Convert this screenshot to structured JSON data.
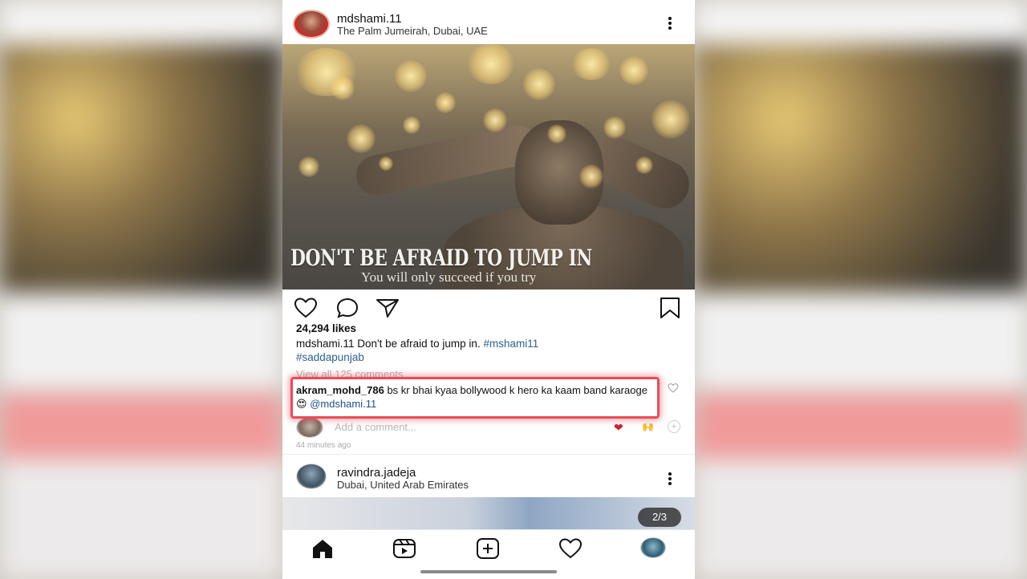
{
  "post1": {
    "username": "mdshami.11",
    "location": "The Palm Jumeirah, Dubai, UAE",
    "image_headline": "DON'T BE AFRAID TO JUMP IN",
    "image_subline": "You will only succeed if you try",
    "likes": "24,294 likes",
    "caption_user": "mdshami.11",
    "caption_text": " Don't be afraid to jump in. ",
    "caption_tag1": "#mshami11",
    "caption_tag2": "#saddapunjab",
    "view_all": "View all 125 comments"
  },
  "comment": {
    "username": "akram_mohd_786",
    "text": " bs kr bhai kyaa bollywood k hero ka kaam band karaoge ",
    "emoji": "😍",
    "mention": "@mdshami.11"
  },
  "add_comment": {
    "placeholder": "Add a comment...",
    "quick_heart": "❤",
    "quick_emoji": "🙌",
    "quick_plus": "+",
    "time_ago": "44 minutes ago"
  },
  "post2": {
    "username": "ravindra.jadeja",
    "location": "Dubai, United Arab Emirates",
    "counter": "2/3"
  },
  "icons": {
    "like": "heart-icon",
    "comment": "comment-icon",
    "share": "send-icon",
    "save": "bookmark-icon",
    "nav_home": "home-icon",
    "nav_reels": "reels-icon",
    "nav_new": "new-post-icon",
    "nav_activity": "activity-heart-icon"
  },
  "colors": {
    "highlight": "#e84d57",
    "hashtag": "#2f5f8f",
    "mention": "#1f4d8a"
  }
}
